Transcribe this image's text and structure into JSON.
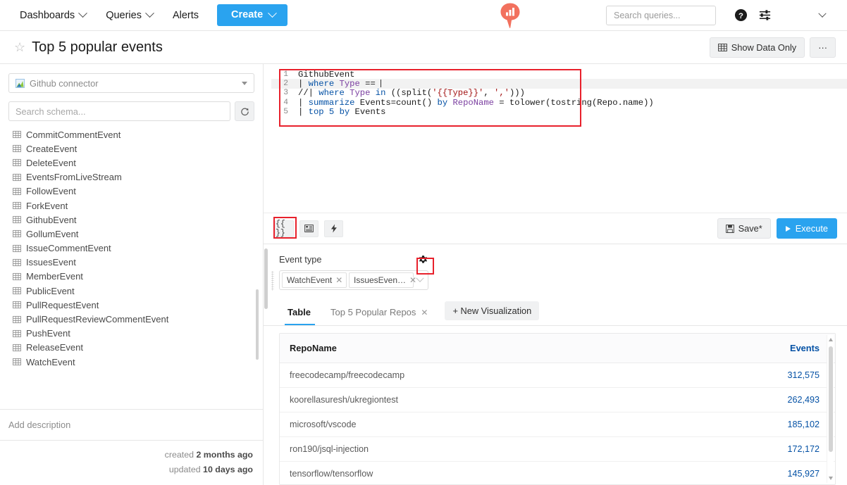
{
  "topnav": {
    "items": [
      {
        "label": "Dashboards",
        "caret": true
      },
      {
        "label": "Queries",
        "caret": true
      },
      {
        "label": "Alerts",
        "caret": false
      }
    ],
    "create_label": "Create",
    "logo_name": "adx-logo",
    "logo_color": "#f2715e",
    "search": {
      "placeholder": "Search queries...",
      "value": ""
    },
    "help_icon": "help-circle-icon",
    "settings_icon": "sliders-icon",
    "account_caret_icon": "chevron-down-icon"
  },
  "titlebar": {
    "star_icon": "star-outline-icon",
    "title": "Top 5 popular events",
    "show_data_only": "Show Data Only",
    "more_label": "···"
  },
  "sidebar": {
    "connector": {
      "label": "Github connector",
      "icon": "database-connector-icon"
    },
    "schema_search": {
      "placeholder": "Search schema...",
      "value": ""
    },
    "refresh_icon": "refresh-icon",
    "tables": [
      "CommitCommentEvent",
      "CreateEvent",
      "DeleteEvent",
      "EventsFromLiveStream",
      "FollowEvent",
      "ForkEvent",
      "GithubEvent",
      "GollumEvent",
      "IssueCommentEvent",
      "IssuesEvent",
      "MemberEvent",
      "PublicEvent",
      "PullRequestEvent",
      "PullRequestReviewCommentEvent",
      "PushEvent",
      "ReleaseEvent",
      "WatchEvent"
    ],
    "description_placeholder": "Add description",
    "meta": {
      "created_prefix": "created ",
      "created_value": "2 months ago",
      "updated_prefix": "updated ",
      "updated_value": "10 days ago"
    }
  },
  "editor": {
    "lines": [
      {
        "n": "1",
        "highlighted": false,
        "tokens": [
          {
            "t": "GithubEvent",
            "c": "fn"
          }
        ]
      },
      {
        "n": "2",
        "highlighted": true,
        "tokens": [
          {
            "t": "| ",
            "c": "fn"
          },
          {
            "t": "where",
            "c": "kw"
          },
          {
            "t": " ",
            "c": "fn"
          },
          {
            "t": "Type",
            "c": "kw2"
          },
          {
            "t": " == ",
            "c": "fn"
          }
        ]
      },
      {
        "n": "3",
        "highlighted": false,
        "tokens": [
          {
            "t": "//| ",
            "c": "fn"
          },
          {
            "t": "where",
            "c": "kw"
          },
          {
            "t": " ",
            "c": "fn"
          },
          {
            "t": "Type",
            "c": "kw2"
          },
          {
            "t": " ",
            "c": "fn"
          },
          {
            "t": "in",
            "c": "kw"
          },
          {
            "t": " ((split(",
            "c": "fn"
          },
          {
            "t": "'{{Type}}'",
            "c": "str"
          },
          {
            "t": ", ",
            "c": "fn"
          },
          {
            "t": "','",
            "c": "str"
          },
          {
            "t": ")))",
            "c": "fn"
          }
        ]
      },
      {
        "n": "4",
        "highlighted": false,
        "tokens": [
          {
            "t": "| ",
            "c": "fn"
          },
          {
            "t": "summarize",
            "c": "kw"
          },
          {
            "t": " Events=count() ",
            "c": "fn"
          },
          {
            "t": "by",
            "c": "kw"
          },
          {
            "t": " ",
            "c": "fn"
          },
          {
            "t": "RepoName",
            "c": "kw2"
          },
          {
            "t": " = tolower(tostring(Repo.name))",
            "c": "fn"
          }
        ]
      },
      {
        "n": "5",
        "highlighted": false,
        "tokens": [
          {
            "t": "| ",
            "c": "fn"
          },
          {
            "t": "top",
            "c": "kw"
          },
          {
            "t": " ",
            "c": "fn"
          },
          {
            "t": "5",
            "c": "num"
          },
          {
            "t": " ",
            "c": "fn"
          },
          {
            "t": "by",
            "c": "kw"
          },
          {
            "t": " Events",
            "c": "fn"
          }
        ]
      }
    ],
    "raw_text": "GithubEvent\n| where Type == \n//| where Type in ((split('{{Type}}', ',')))\n| summarize Events=count() by RepoName = tolower(tostring(Repo.name))\n| top 5 by Events"
  },
  "editor_toolbar": {
    "params_label": "{{ }}",
    "panel_icon": "panel-list-icon",
    "lightning_icon": "lightning-bolt-icon",
    "save_label": "Save*",
    "save_icon": "floppy-disk-icon",
    "execute_label": "Execute",
    "execute_icon": "play-icon"
  },
  "parameters": {
    "label": "Event type",
    "gear_icon": "gear-icon",
    "chips": [
      {
        "label": "WatchEvent"
      },
      {
        "label": "IssuesEven…"
      }
    ],
    "dropdown_icon": "chevron-down-icon"
  },
  "viz_tabs": {
    "tabs": [
      {
        "label": "Table",
        "active": true,
        "closable": false
      },
      {
        "label": "Top 5 Popular Repos",
        "active": false,
        "closable": true
      }
    ],
    "new_visualization": "+ New Visualization"
  },
  "results_table": {
    "columns": [
      "RepoName",
      "Events"
    ],
    "rows": [
      {
        "RepoName": "freecodecamp/freecodecamp",
        "Events": "312,575"
      },
      {
        "RepoName": "koorellasuresh/ukregiontest",
        "Events": "262,493"
      },
      {
        "RepoName": "microsoft/vscode",
        "Events": "185,102"
      },
      {
        "RepoName": "ron190/jsql-injection",
        "Events": "172,172"
      },
      {
        "RepoName": "tensorflow/tensorflow",
        "Events": "145,927"
      }
    ]
  },
  "annotations": {
    "highlight_color": "#e8212c",
    "boxes": [
      "query-editor",
      "parameters-toolbar-button",
      "parameters-gear-button"
    ]
  },
  "chart_data": {
    "type": "table",
    "title": "Top 5 popular events",
    "columns": [
      "RepoName",
      "Events"
    ],
    "categories": [
      "freecodecamp/freecodecamp",
      "koorellasuresh/ukregiontest",
      "microsoft/vscode",
      "ron190/jsql-injection",
      "tensorflow/tensorflow"
    ],
    "values": [
      312575,
      262493,
      185102,
      172172,
      145927
    ],
    "xlabel": "RepoName",
    "ylabel": "Events"
  }
}
